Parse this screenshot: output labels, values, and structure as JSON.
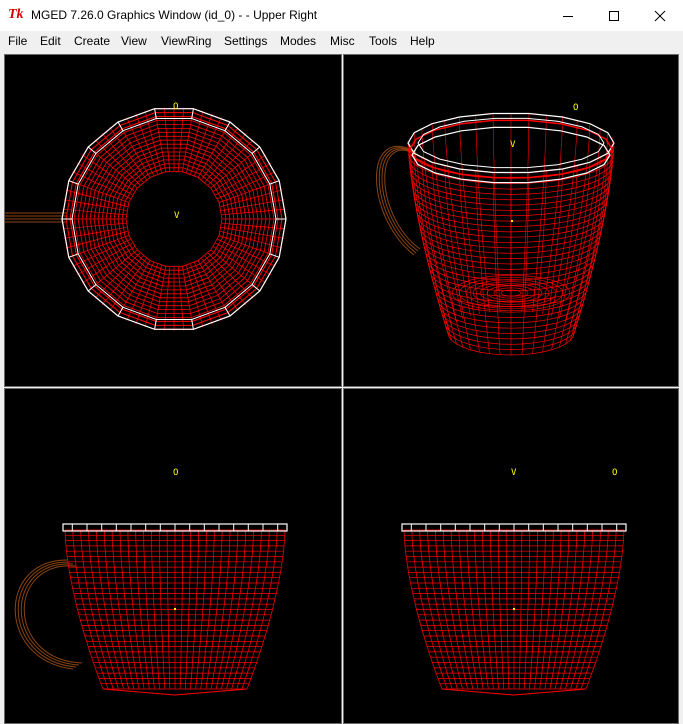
{
  "window": {
    "app_icon": "Tk",
    "title": "MGED 7.26.0 Graphics Window (id_0) -  - Upper Right",
    "buttons": {
      "minimize": "minimize-icon",
      "maximize": "maximize-icon",
      "close": "close-icon"
    }
  },
  "menu": [
    "File",
    "Edit",
    "Create",
    "View",
    "ViewRing",
    "Settings",
    "Modes",
    "Misc",
    "Tools",
    "Help"
  ],
  "views": {
    "upper_left": {
      "labels": [
        "O",
        "V"
      ]
    },
    "upper_right": {
      "labels": [
        "O",
        "V"
      ]
    },
    "lower_left": {
      "labels": [
        "O"
      ]
    },
    "lower_right": {
      "labels": [
        "V",
        "O"
      ]
    }
  },
  "colors": {
    "wire": "#ff0000",
    "edge": "#ffffff",
    "handle": "#8b4513",
    "label": "#ffff00",
    "background": "#000000"
  }
}
